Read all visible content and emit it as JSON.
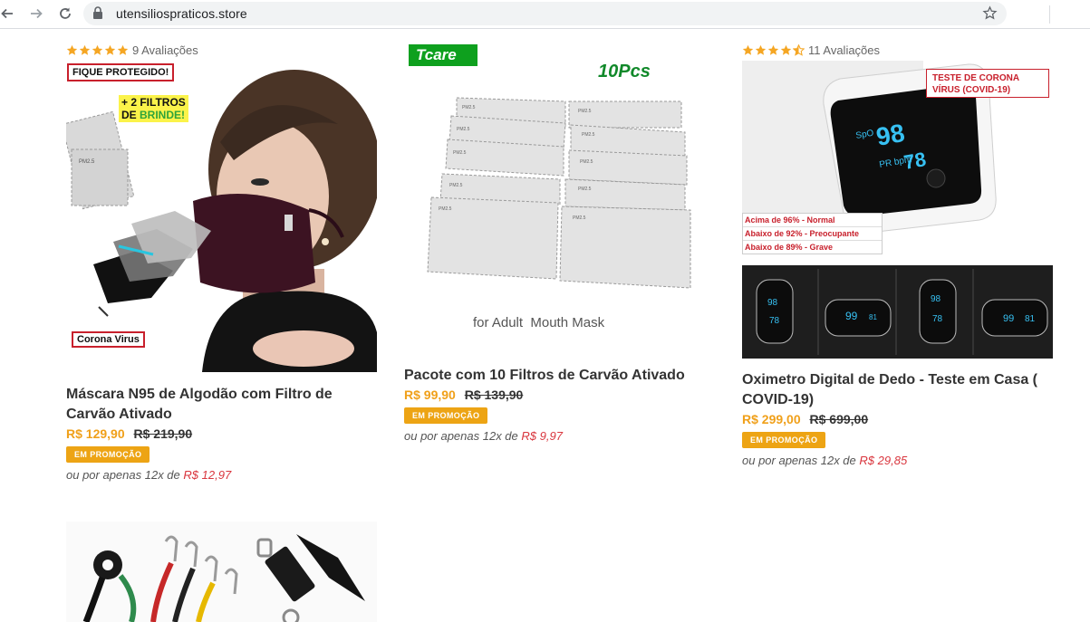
{
  "browser": {
    "url": "utensiliospraticos.store"
  },
  "products": [
    {
      "rating_text": "9 Avaliações",
      "rating_value": 5,
      "title": "Máscara N95 de Algodão com Filtro de Carvão Ativado",
      "price_now": "R$ 129,90",
      "price_old": "R$ 219,90",
      "promo": "EM PROMOÇÃO",
      "installments_prefix": "ou por apenas 12x de",
      "installments_value": "R$ 12,97",
      "image": {
        "badge_top": "FIQUE PROTEGIDO!",
        "filters_line1": "+ 2 FILTROS",
        "filters_line2a": "DE ",
        "filters_line2b": "BRINDE!",
        "badge_bottom": "Corona Virus",
        "pm_label": "PM2.5"
      }
    },
    {
      "title": "Pacote com 10 Filtros de Carvão Ativado",
      "price_now": "R$ 99,90",
      "price_old": "R$ 139,90",
      "promo": "EM PROMOÇÃO",
      "installments_prefix": "ou por apenas 12x de",
      "installments_value": "R$ 9,97",
      "image": {
        "brand": "Tcare",
        "count": "10Pcs",
        "caption": "for Adult  Mouth Mask",
        "pm_label": "PM2.5"
      }
    },
    {
      "rating_text": "11 Avaliações",
      "rating_value": 4.5,
      "title": "Oximetro Digital de Dedo - Teste em Casa ( COVID-19)",
      "price_now": "R$ 299,00",
      "price_old": "R$ 699,00",
      "promo": "EM PROMOÇÃO",
      "installments_prefix": "ou por apenas 12x de",
      "installments_value": "R$ 29,85",
      "image": {
        "test_line1": "TESTE DE CORONA",
        "test_line2": "VÍRUS (COVID-19)",
        "spo2_label": "SpO",
        "spo2_value": "98",
        "pr_label": "PR bpm",
        "pr_value": "78",
        "legend": [
          "Acima de 96% - Normal",
          "Abaixo de 92% - Preocupante",
          "Abaixo de 89% - Grave"
        ],
        "mini_a_top": "98",
        "mini_a_bottom": "78",
        "mini_b_left": "99",
        "mini_b_right": "81"
      }
    }
  ],
  "colors": {
    "price": "#f0a01a",
    "promo_bg": "#eda414",
    "installment_value": "#d9363e",
    "star": "#f5a623"
  }
}
